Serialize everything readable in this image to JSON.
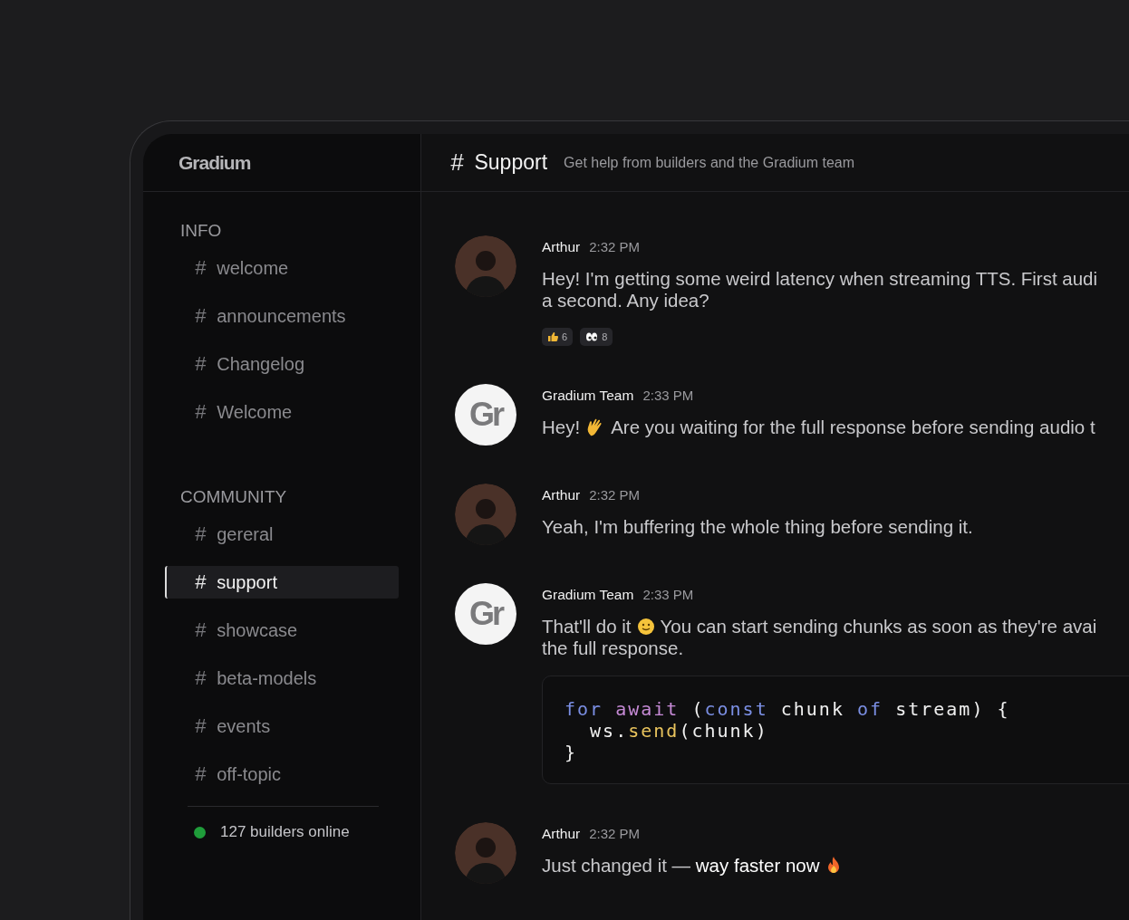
{
  "sidebar": {
    "logo": "Gradium",
    "sections": [
      {
        "title": "INFO",
        "items": [
          {
            "hash": "#",
            "label": "welcome",
            "selected": false
          },
          {
            "hash": "#",
            "label": "announcements",
            "selected": false
          },
          {
            "hash": "#",
            "label": "Changelog",
            "selected": false
          },
          {
            "hash": "#",
            "label": "Welcome",
            "selected": false
          }
        ]
      },
      {
        "title": "COMMUNITY",
        "items": [
          {
            "hash": "#",
            "label": "gereral",
            "selected": false
          },
          {
            "hash": "#",
            "label": "support",
            "selected": true
          },
          {
            "hash": "#",
            "label": "showcase",
            "selected": false
          },
          {
            "hash": "#",
            "label": "beta-models",
            "selected": false
          },
          {
            "hash": "#",
            "label": "events",
            "selected": false
          },
          {
            "hash": "#",
            "label": "off-topic",
            "selected": false
          }
        ]
      }
    ],
    "online": {
      "text": "127 builders online",
      "color": "#1f9d3a"
    }
  },
  "channel": {
    "hash": "#",
    "name": "Support",
    "description": "Get help from builders and the Gradium team"
  },
  "messages": [
    {
      "author": "Arthur",
      "time": "2:32 PM",
      "avatar": {
        "kind": "photo"
      },
      "lines": [
        [
          {
            "kind": "text",
            "text": "Hey! I'm getting some weird latency when streaming TTS. First audi"
          }
        ],
        [
          {
            "kind": "text",
            "text": "a second. Any idea?"
          }
        ]
      ],
      "reactions": [
        {
          "kind": "thumbs",
          "count": "6"
        },
        {
          "kind": "eyes",
          "count": "8"
        }
      ]
    },
    {
      "author": "Gradium Team",
      "time": "2:33 PM",
      "avatar": {
        "kind": "initials",
        "text": "Gr"
      },
      "lines": [
        [
          {
            "kind": "text",
            "text": "Hey!"
          },
          {
            "kind": "hand"
          },
          {
            "kind": "text",
            "text": "Are you waiting for the full response before sending audio t"
          }
        ]
      ]
    },
    {
      "author": "Arthur",
      "time": "2:32 PM",
      "avatar": {
        "kind": "photo"
      },
      "lines": [
        [
          {
            "kind": "text",
            "text": "Yeah, I'm buffering the whole thing before sending it."
          }
        ]
      ]
    },
    {
      "author": "Gradium Team",
      "time": "2:33 PM",
      "avatar": {
        "kind": "initials",
        "text": "Gr"
      },
      "lines": [
        [
          {
            "kind": "text",
            "text": "That'll do it"
          },
          {
            "kind": "smile"
          },
          {
            "kind": "text",
            "text": "You can start sending chunks as soon as they're avai"
          }
        ],
        [
          {
            "kind": "text",
            "text": "the full response."
          }
        ]
      ],
      "code": [
        [
          {
            "kind": "keyword",
            "text": "for "
          },
          {
            "kind": "control",
            "text": "await"
          },
          {
            "kind": "plain",
            "text": " ("
          },
          {
            "kind": "keyword",
            "text": "const"
          },
          {
            "kind": "plain",
            "text": " chunk "
          },
          {
            "kind": "keyword",
            "text": "of"
          },
          {
            "kind": "plain",
            "text": " stream) {"
          }
        ],
        [
          {
            "kind": "plain",
            "text": "  ws."
          },
          {
            "kind": "function",
            "text": "send"
          },
          {
            "kind": "plain",
            "text": "(chunk)"
          }
        ],
        [
          {
            "kind": "plain",
            "text": "}"
          }
        ]
      ]
    },
    {
      "author": "Arthur",
      "time": "2:32 PM",
      "avatar": {
        "kind": "photo"
      },
      "lines": [
        [
          {
            "kind": "text",
            "text": "Just changed it — **way faster now**"
          },
          {
            "kind": "flame"
          }
        ]
      ]
    }
  ]
}
